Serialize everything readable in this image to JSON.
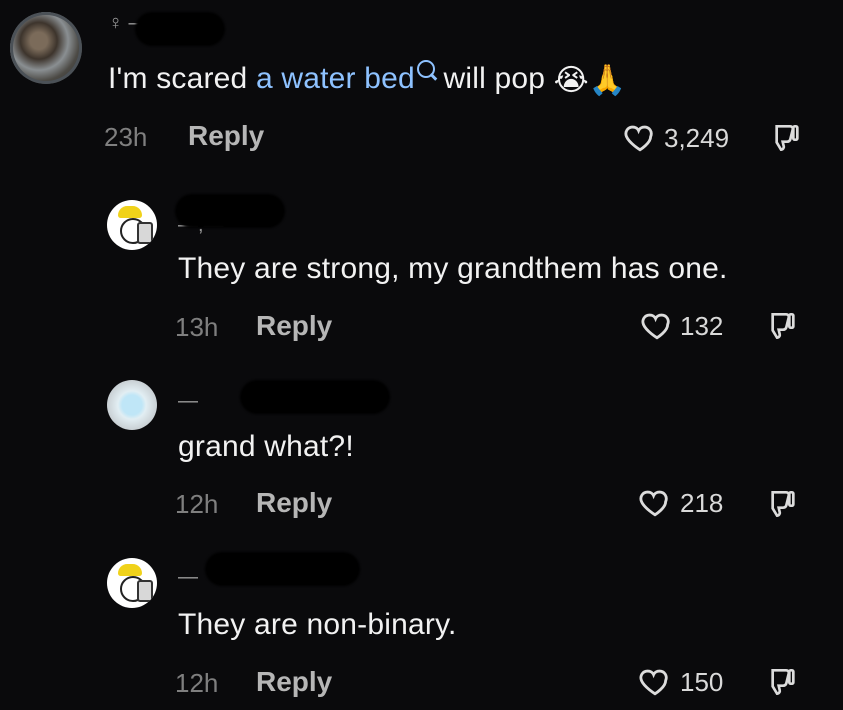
{
  "comments": [
    {
      "username_fragment": "♀ —",
      "text_before": "I'm scared ",
      "link_text": "a water bed",
      "text_after": " will pop",
      "emojis": "😭🙏",
      "time": "23h",
      "reply_label": "Reply",
      "likes": "3,249",
      "avatar": "brown-photo-avatar"
    },
    {
      "username_fragment": "—,—",
      "text": "They are strong, my grandthem has one.",
      "time": "13h",
      "reply_label": "Reply",
      "likes": "132",
      "avatar": "chef-cartoon-avatar"
    },
    {
      "username_fragment": "—",
      "text": "grand what?!",
      "time": "12h",
      "reply_label": "Reply",
      "likes": "218",
      "avatar": "light-blue-avatar"
    },
    {
      "username_fragment": "—",
      "text": "They are non-binary.",
      "time": "12h",
      "reply_label": "Reply",
      "likes": "150",
      "avatar": "chef-cartoon-avatar"
    }
  ],
  "icons": {
    "like": "heart-outline-icon",
    "dislike": "thumbs-down-outline-icon"
  }
}
